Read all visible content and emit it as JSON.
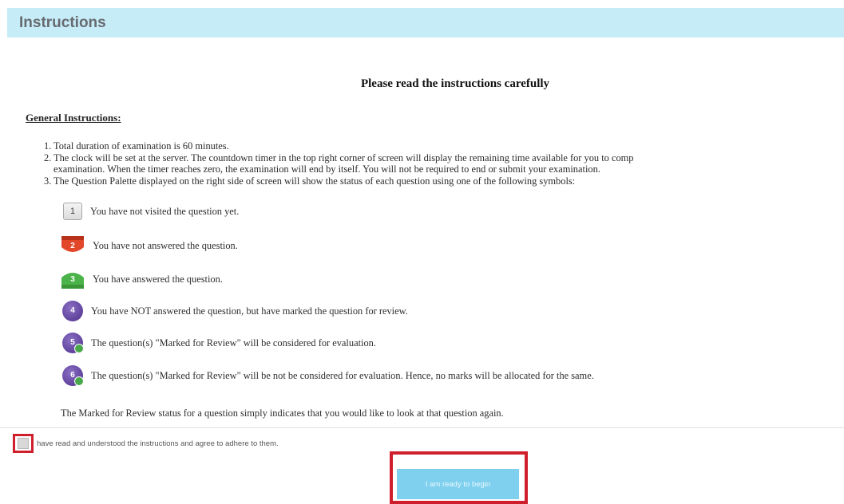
{
  "header": {
    "title": "Instructions"
  },
  "page_heading": "Please read the instructions carefully",
  "section_heading": "General Instructions:",
  "instructions": [
    {
      "num": "1.",
      "line1": "Total duration of examination is 60 minutes.",
      "line2": ""
    },
    {
      "num": "2.",
      "line1": "The clock will be set at the server. The countdown timer in the top right corner of screen will display the remaining time available for you to comp",
      "line2": "examination. When the timer reaches zero, the examination will end by itself. You will not be required to end or submit your examination."
    },
    {
      "num": "3.",
      "line1": "The Question Palette displayed on the right side of screen will show the status of each question using one of the following symbols:",
      "line2": ""
    }
  ],
  "legend": [
    {
      "symbol": "not-visited",
      "number": "1",
      "color": "#e6e6e6",
      "text": "You have not visited the question yet."
    },
    {
      "symbol": "not-answered",
      "number": "2",
      "color": "#e2472a",
      "text": "You have not answered the question."
    },
    {
      "symbol": "answered",
      "number": "3",
      "color": "#4cb34a",
      "text": "You have answered the question."
    },
    {
      "symbol": "marked-for-review",
      "number": "4",
      "color": "#5c3d99",
      "text": "You have NOT answered the question, but have marked the question for review."
    },
    {
      "symbol": "answered-marked-for-review",
      "number": "5",
      "color": "#5c3d99",
      "text": "The question(s) \"Marked for Review\" will be considered for evaluation."
    },
    {
      "symbol": "answered-marked-for-review",
      "number": "6",
      "color": "#5c3d99",
      "text": "The question(s) \"Marked for Review\" will be not be considered for evaluation. Hence, no marks will be allocated for the same."
    }
  ],
  "review_note": "The Marked for Review status for a question simply indicates that you would like to look at that question again.",
  "agreement": {
    "label": "have read and understood the instructions and agree to adhere to them.",
    "checked": false
  },
  "begin_button": {
    "label": "I am ready to begin"
  },
  "colors": {
    "header_bg": "#c6ecf8",
    "button_bg": "#7fd0ee",
    "highlight_red": "#cf1f2c"
  }
}
